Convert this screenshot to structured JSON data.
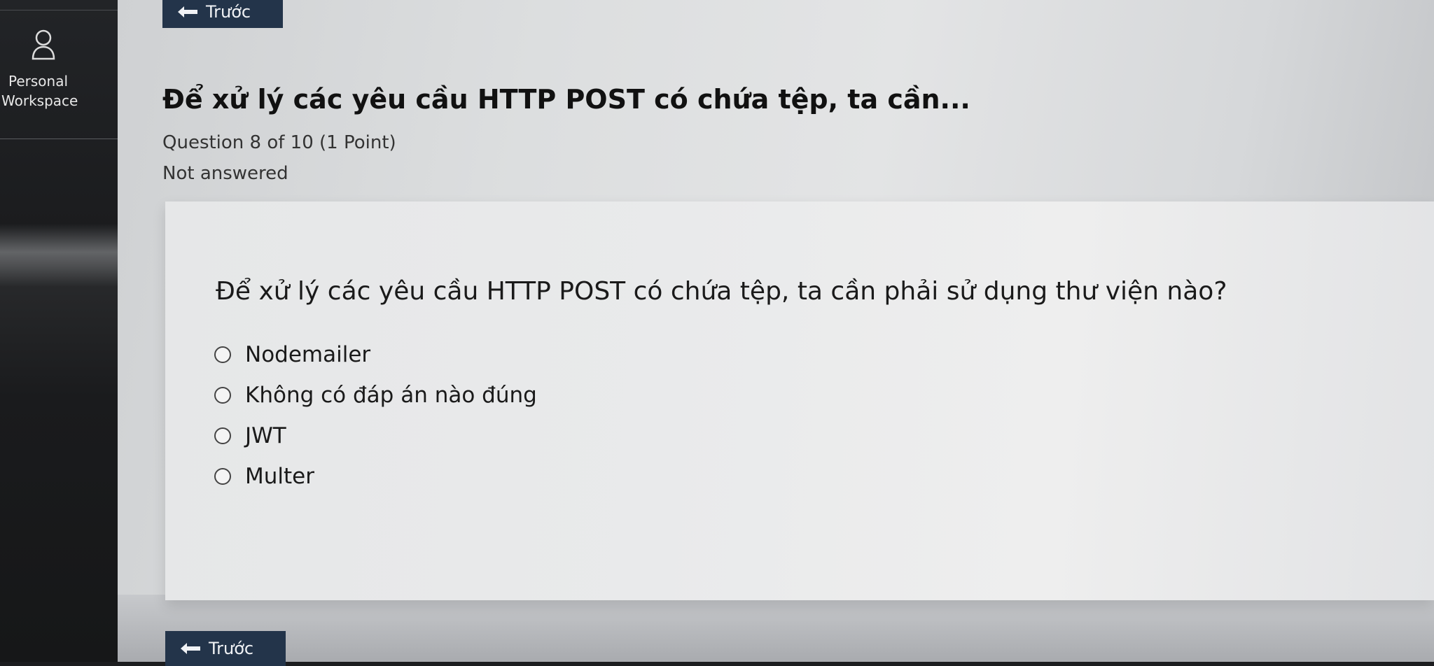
{
  "sidebar": {
    "workspace_line1": "Personal",
    "workspace_line2": "Workspace",
    "icon": "user-icon"
  },
  "nav": {
    "prev_label": "Trước",
    "prev_icon": "arrow-left-icon"
  },
  "question": {
    "title": "Để xử lý các yêu cầu HTTP POST có chứa tệp, ta cần...",
    "meta_line1": "Question 8 of 10 (1 Point)",
    "meta_line2": "Not answered",
    "text": "Để xử lý các yêu cầu HTTP POST có chứa tệp, ta cần phải sử dụng thư viện nào?",
    "options": [
      {
        "label": "Nodemailer"
      },
      {
        "label": "Không có đáp án nào đúng"
      },
      {
        "label": "JWT"
      },
      {
        "label": "Multer"
      }
    ]
  },
  "colors": {
    "button_bg": "#23344a",
    "sidebar_bg": "#1c1d1f"
  }
}
